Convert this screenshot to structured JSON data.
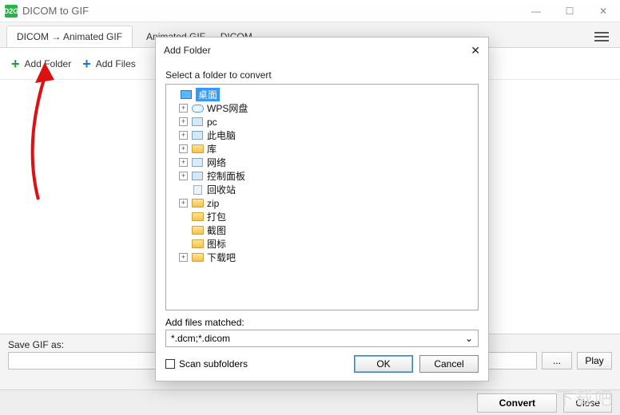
{
  "window": {
    "title": "DICOM to GIF",
    "logo_text": "D2G"
  },
  "tabs": {
    "t1": "DICOM  →  Animated GIF",
    "t2": "Animated GIF  →  DICOM"
  },
  "toolbar": {
    "add_folder": "Add Folder",
    "add_files": "Add Files"
  },
  "bottom": {
    "save_label": "Save GIF as:",
    "browse": "...",
    "play": "Play",
    "convert": "Convert",
    "close": "Close"
  },
  "dialog": {
    "title": "Add Folder",
    "select_label": "Select a folder to convert",
    "tree": {
      "root": "桌面",
      "items": [
        {
          "expander": "+",
          "icon": "cloud",
          "label": "WPS网盘"
        },
        {
          "expander": "+",
          "icon": "pc",
          "label": "pc"
        },
        {
          "expander": "+",
          "icon": "pc",
          "label": "此电脑"
        },
        {
          "expander": "+",
          "icon": "fld",
          "label": "库"
        },
        {
          "expander": "+",
          "icon": "net",
          "label": "网络"
        },
        {
          "expander": "+",
          "icon": "pc",
          "label": "控制面板"
        },
        {
          "expander": "",
          "icon": "bin",
          "label": "回收站"
        },
        {
          "expander": "+",
          "icon": "fld",
          "label": "zip"
        },
        {
          "expander": "",
          "icon": "fld",
          "label": "打包"
        },
        {
          "expander": "",
          "icon": "fld",
          "label": "截图"
        },
        {
          "expander": "",
          "icon": "fld",
          "label": "图标"
        },
        {
          "expander": "+",
          "icon": "fld",
          "label": "下载吧"
        }
      ]
    },
    "match_label": "Add files matched:",
    "match_value": "*.dcm;*.dicom",
    "scan_label": "Scan subfolders",
    "ok": "OK",
    "cancel": "Cancel"
  },
  "watermark": "下载吧"
}
